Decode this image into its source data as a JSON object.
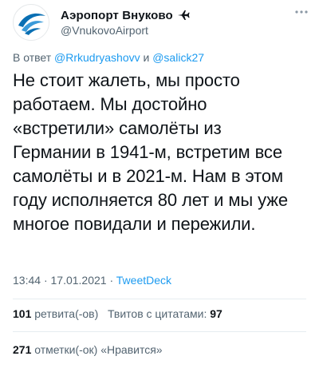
{
  "account": {
    "display_name": "Аэропорт Внуково",
    "handle": "@VnukovoAirport",
    "avatar_icon": "vnukovo-logo-icon",
    "badge_icon": "airplane-icon"
  },
  "reply": {
    "prefix": "В ответ",
    "mention1": "@Rrkudryashovv",
    "joiner": "и",
    "mention2": "@salick27"
  },
  "tweet": {
    "lines": [
      "Не стоит жалеть, мы просто",
      "работаем. Мы достойно",
      "«встретили» самолёты из",
      "Германии в 1941-м, встретим все",
      "самолёты и в 2021-м. Нам в этом",
      "году исполняется 80 лет и мы уже",
      "многое повидали и пережили."
    ]
  },
  "meta": {
    "time": "13:44",
    "sep1": "·",
    "date": "17.01.2021",
    "sep2": "·",
    "source": "TweetDeck"
  },
  "stats": {
    "retweets_count": "101",
    "retweets_label": "ретвита(-ов)",
    "quotes_label": "Твитов с цитатами:",
    "quotes_count": "97",
    "likes_count": "271",
    "likes_label": "отметки(-ок) «Нравится»"
  },
  "colors": {
    "link": "#1d9bf0",
    "secondary_text": "#536471",
    "brand": "#0a6fb3"
  }
}
